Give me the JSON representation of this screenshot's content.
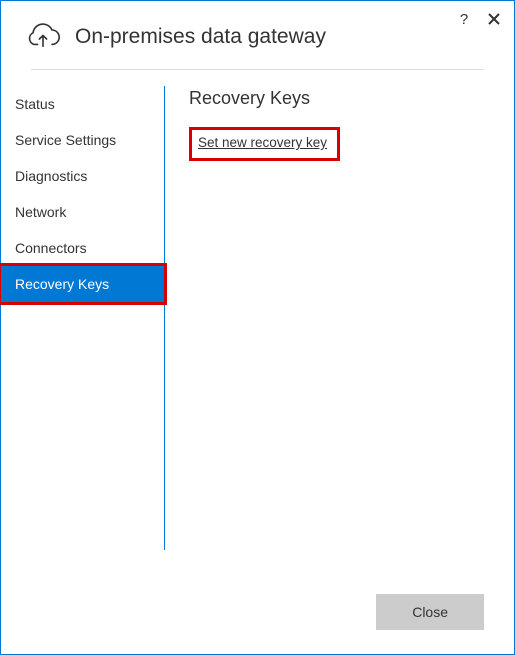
{
  "title": "On-premises data gateway",
  "controls": {
    "help": "?",
    "close": "✕"
  },
  "sidebar": {
    "items": [
      {
        "label": "Status",
        "selected": false
      },
      {
        "label": "Service Settings",
        "selected": false
      },
      {
        "label": "Diagnostics",
        "selected": false
      },
      {
        "label": "Network",
        "selected": false
      },
      {
        "label": "Connectors",
        "selected": false
      },
      {
        "label": "Recovery Keys",
        "selected": true
      }
    ]
  },
  "main": {
    "heading": "Recovery Keys",
    "link_label": "Set new recovery key"
  },
  "footer": {
    "close_label": "Close"
  }
}
